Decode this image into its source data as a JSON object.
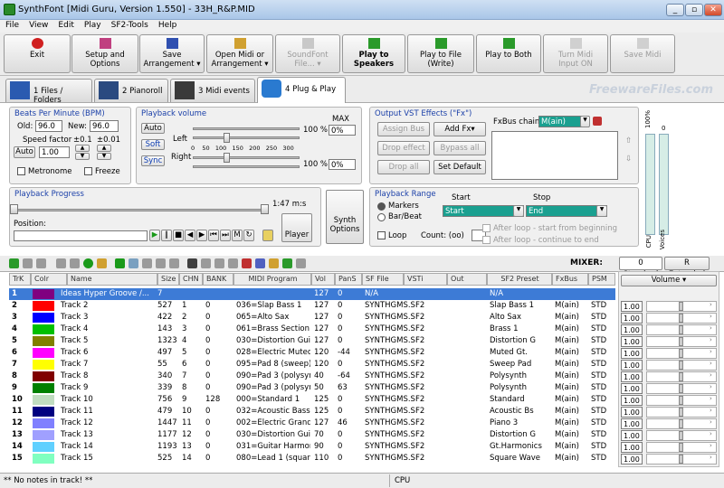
{
  "window": {
    "title": "SynthFont [Midi Guru, Version 1.550] - 33H_R&P.MID"
  },
  "menu": [
    "File",
    "View",
    "Edit",
    "Play",
    "SF2-Tools",
    "Help"
  ],
  "toolbar": {
    "exit": "Exit",
    "setup1": "Setup and",
    "setup2": "Options",
    "save1": "Save",
    "save2": "Arrangement",
    "open1": "Open Midi or",
    "open2": "Arrangement",
    "sf1": "SoundFont",
    "sf2": "File...",
    "ps1": "Play to",
    "ps2": "Speakers",
    "pf1": "Play to File",
    "pf2": "(Write)",
    "pb": "Play to Both",
    "tm1": "Turn Midi",
    "tm2": "Input ON",
    "savemidi": "Save Midi"
  },
  "tabs": [
    "1 Files / Folders",
    "2 Pianoroll",
    "3 Midi events",
    "4 Plug & Play"
  ],
  "watermark": "FreewareFiles.com",
  "bpm": {
    "title": "Beats Per Minute (BPM)",
    "old_label": "Old:",
    "old": "96.0",
    "new_label": "New:",
    "new": "96.0",
    "speed_label": "Speed factor",
    "step1": "±0.1",
    "step2": "±0.01",
    "auto": "Auto",
    "speed": "1.00",
    "metronome": "Metronome",
    "freeze": "Freeze"
  },
  "volume": {
    "title": "Playback volume",
    "auto": "Auto",
    "soft": "Soft",
    "sync": "Sync",
    "left": "Left",
    "right": "Right",
    "max": "MAX",
    "pct_left": "100 %",
    "max_left": "0%",
    "pct_right": "100 %",
    "max_right": "0%",
    "scale": [
      "0",
      "50",
      "100",
      "150",
      "200",
      "250",
      "300"
    ]
  },
  "vst": {
    "title": "Output VST Effects (\"Fx\")",
    "assign": "Assign Bus",
    "addfx": "Add Fx▾",
    "drop": "Drop effect",
    "bypass": "Bypass all",
    "dropall": "Drop all",
    "setdefault": "Set Default",
    "chain_label": "FxBus chain:",
    "chain": "M(ain)"
  },
  "meters": {
    "pct": "100%",
    "zero": "0",
    "cpu": "CPU",
    "voices": "Voices"
  },
  "progress": {
    "title": "Playback Progress",
    "time": "1:47 m:s",
    "position": "Position:",
    "player": "Player"
  },
  "synth": {
    "line1": "Synth",
    "line2": "Options"
  },
  "range": {
    "title": "Playback Range",
    "start": "Start",
    "stop": "Stop",
    "markers": "Markers",
    "barbeat": "Bar/Beat",
    "start_val": "Start",
    "end_val": "End",
    "loop": "Loop",
    "count_label": "Count: (oo)",
    "after1": "After loop - start from beginning",
    "after2": "After loop - continue to end"
  },
  "mixer": {
    "label": "MIXER:",
    "std": "0 Standard",
    "ext": "R Extended",
    "vol_header": "Volume ▾"
  },
  "columns": [
    "TrK",
    "Colr",
    "Name",
    "Size",
    "CHN",
    "BANK",
    "MIDI Program",
    "Vol",
    "PanS",
    "SF File",
    "VSTi",
    "Out",
    "SF2 Preset",
    "FxBus",
    "PSM"
  ],
  "tracks": [
    {
      "n": "1",
      "color": "#800080",
      "name": "Ideas Hyper Groove /...",
      "size": "7",
      "chn": "",
      "bank": "",
      "prog": "",
      "vol": "127",
      "pan": "0",
      "sf": "N/A",
      "preset": "N/A",
      "fx": "",
      "psm": "",
      "sel": true
    },
    {
      "n": "2",
      "color": "#ff0000",
      "name": "Track 2",
      "size": "527",
      "chn": "1",
      "bank": "0",
      "prog": "036=Slap Bass 1",
      "vol": "127",
      "pan": "0",
      "sf": "SYNTHGMS.SF2",
      "preset": "Slap Bass 1",
      "fx": "M(ain)",
      "psm": "STD"
    },
    {
      "n": "3",
      "color": "#0000ff",
      "name": "Track 3",
      "size": "422",
      "chn": "2",
      "bank": "0",
      "prog": "065=Alto Sax",
      "vol": "127",
      "pan": "0",
      "sf": "SYNTHGMS.SF2",
      "preset": "Alto Sax",
      "fx": "M(ain)",
      "psm": "STD"
    },
    {
      "n": "4",
      "color": "#00c000",
      "name": "Track 4",
      "size": "143",
      "chn": "3",
      "bank": "0",
      "prog": "061=Brass Section",
      "vol": "127",
      "pan": "0",
      "sf": "SYNTHGMS.SF2",
      "preset": "Brass 1",
      "fx": "M(ain)",
      "psm": "STD"
    },
    {
      "n": "5",
      "color": "#808000",
      "name": "Track 5",
      "size": "1323",
      "chn": "4",
      "bank": "0",
      "prog": "030=Distortion Guitar",
      "vol": "127",
      "pan": "0",
      "sf": "SYNTHGMS.SF2",
      "preset": "Distortion G",
      "fx": "M(ain)",
      "psm": "STD"
    },
    {
      "n": "6",
      "color": "#ff00ff",
      "name": "Track 6",
      "size": "497",
      "chn": "5",
      "bank": "0",
      "prog": "028=Electric Muted G...",
      "vol": "120",
      "pan": "-44",
      "sf": "SYNTHGMS.SF2",
      "preset": "Muted Gt.",
      "fx": "M(ain)",
      "psm": "STD"
    },
    {
      "n": "7",
      "color": "#ffff00",
      "name": "Track 7",
      "size": "55",
      "chn": "6",
      "bank": "0",
      "prog": "095=Pad 8 (sweep)",
      "vol": "120",
      "pan": "0",
      "sf": "SYNTHGMS.SF2",
      "preset": "Sweep Pad",
      "fx": "M(ain)",
      "psm": "STD"
    },
    {
      "n": "8",
      "color": "#800000",
      "name": "Track 8",
      "size": "340",
      "chn": "7",
      "bank": "0",
      "prog": "090=Pad 3 (polysynth)",
      "vol": "40",
      "pan": "-64",
      "sf": "SYNTHGMS.SF2",
      "preset": "Polysynth",
      "fx": "M(ain)",
      "psm": "STD"
    },
    {
      "n": "9",
      "color": "#008000",
      "name": "Track 9",
      "size": "339",
      "chn": "8",
      "bank": "0",
      "prog": "090=Pad 3 (polysynth)",
      "vol": "50",
      "pan": "63",
      "sf": "SYNTHGMS.SF2",
      "preset": "Polysynth",
      "fx": "M(ain)",
      "psm": "STD"
    },
    {
      "n": "10",
      "color": "#c0dcc0",
      "name": "Track 10",
      "size": "756",
      "chn": "9",
      "bank": "128",
      "prog": "000=Standard 1",
      "vol": "125",
      "pan": "0",
      "sf": "SYNTHGMS.SF2",
      "preset": "Standard",
      "fx": "M(ain)",
      "psm": "STD"
    },
    {
      "n": "11",
      "color": "#000080",
      "name": "Track 11",
      "size": "479",
      "chn": "10",
      "bank": "0",
      "prog": "032=Acoustic Bass",
      "vol": "125",
      "pan": "0",
      "sf": "SYNTHGMS.SF2",
      "preset": "Acoustic Bs",
      "fx": "M(ain)",
      "psm": "STD"
    },
    {
      "n": "12",
      "color": "#8080ff",
      "name": "Track 12",
      "size": "1447",
      "chn": "11",
      "bank": "0",
      "prog": "002=Electric Grand",
      "vol": "127",
      "pan": "46",
      "sf": "SYNTHGMS.SF2",
      "preset": "Piano 3",
      "fx": "M(ain)",
      "psm": "STD"
    },
    {
      "n": "13",
      "color": "#a0a0ff",
      "name": "Track 13",
      "size": "1177",
      "chn": "12",
      "bank": "0",
      "prog": "030=Distortion Guitar",
      "vol": "70",
      "pan": "0",
      "sf": "SYNTHGMS.SF2",
      "preset": "Distortion G",
      "fx": "M(ain)",
      "psm": "STD"
    },
    {
      "n": "14",
      "color": "#60d0ff",
      "name": "Track 14",
      "size": "1193",
      "chn": "13",
      "bank": "0",
      "prog": "031=Guitar Harmonics",
      "vol": "90",
      "pan": "0",
      "sf": "SYNTHGMS.SF2",
      "preset": "Gt.Harmonics",
      "fx": "M(ain)",
      "psm": "STD"
    },
    {
      "n": "15",
      "color": "#80ffc0",
      "name": "Track 15",
      "size": "525",
      "chn": "14",
      "bank": "0",
      "prog": "080=Lead 1 (square)",
      "vol": "110",
      "pan": "0",
      "sf": "SYNTHGMS.SF2",
      "preset": "Square Wave",
      "fx": "M(ain)",
      "psm": "STD"
    }
  ],
  "mixvols": [
    "1.00",
    "1.00",
    "1.00",
    "1.00",
    "1.00",
    "1.00",
    "1.00",
    "1.00",
    "1.00",
    "1.00",
    "1.00",
    "1.00",
    "1.00",
    "1.00"
  ],
  "status": {
    "left": "** No notes in track! **",
    "cpu": "CPU"
  }
}
